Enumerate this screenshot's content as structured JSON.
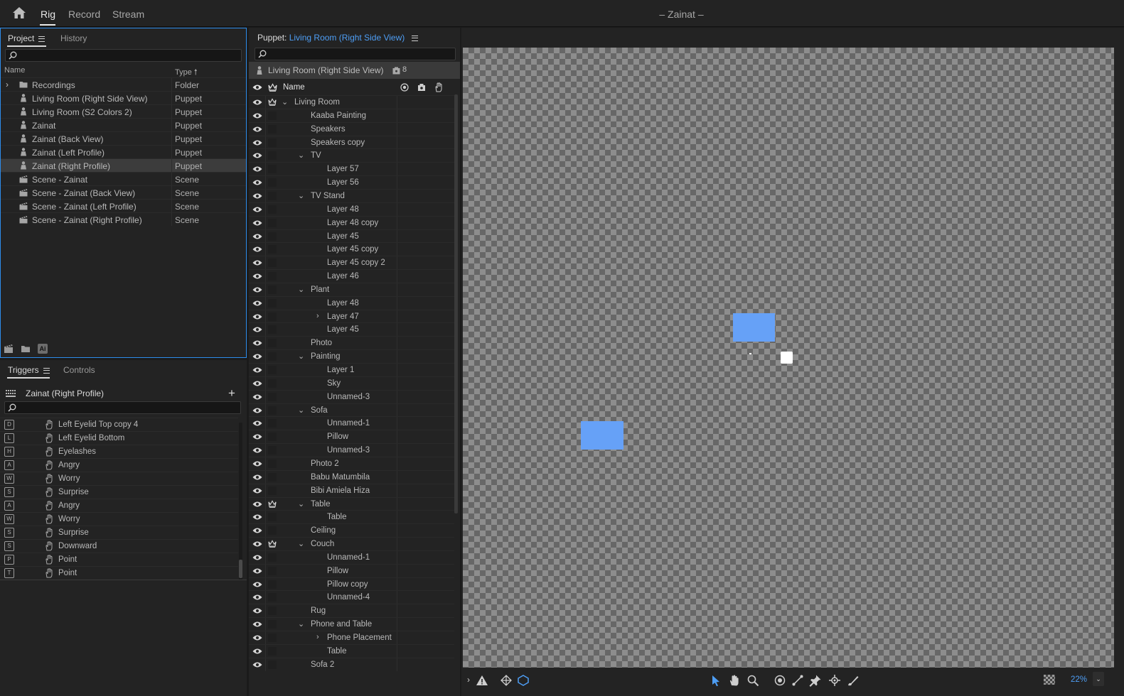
{
  "workspace": {
    "tabs": [
      "Rig",
      "Record",
      "Stream"
    ],
    "active_tab": "Rig",
    "title": "– Zainat –"
  },
  "project_panel": {
    "tabs": [
      "Project",
      "History"
    ],
    "search_placeholder": "",
    "columns": {
      "name": "Name",
      "type": "Type"
    },
    "items": [
      {
        "name": "Recordings",
        "type": "Folder",
        "icon": "folder-icon"
      },
      {
        "name": "Living Room (Right Side View)",
        "type": "Puppet",
        "icon": "puppet-icon"
      },
      {
        "name": "Living Room (S2 Colors 2)",
        "type": "Puppet",
        "icon": "puppet-icon"
      },
      {
        "name": "Zainat",
        "type": "Puppet",
        "icon": "puppet-icon"
      },
      {
        "name": "Zainat (Back View)",
        "type": "Puppet",
        "icon": "puppet-icon"
      },
      {
        "name": "Zainat (Left Profile)",
        "type": "Puppet",
        "icon": "puppet-icon"
      },
      {
        "name": "Zainat (Right Profile)",
        "type": "Puppet",
        "icon": "puppet-icon",
        "selected": true
      },
      {
        "name": "Scene - Zainat",
        "type": "Scene",
        "icon": "scene-icon"
      },
      {
        "name": "Scene - Zainat (Back View)",
        "type": "Scene",
        "icon": "scene-icon"
      },
      {
        "name": "Scene - Zainat (Left Profile)",
        "type": "Scene",
        "icon": "scene-icon"
      },
      {
        "name": "Scene - Zainat (Right Profile)",
        "type": "Scene",
        "icon": "scene-icon"
      }
    ],
    "footer_ai_label": "Ai"
  },
  "triggers_panel": {
    "tabs": [
      "Triggers",
      "Controls"
    ],
    "puppet_name": "Zainat (Right Profile)",
    "add_label": "+",
    "items": [
      {
        "key": "D",
        "name": "Left Eyelid Top copy 4"
      },
      {
        "key": "L",
        "name": "Left Eyelid Bottom"
      },
      {
        "key": "H",
        "name": "Eyelashes"
      },
      {
        "key": "A",
        "name": "Angry"
      },
      {
        "key": "W",
        "name": "Worry"
      },
      {
        "key": "S",
        "name": "Surprise"
      },
      {
        "key": "A",
        "name": "Angry"
      },
      {
        "key": "W",
        "name": "Worry"
      },
      {
        "key": "S",
        "name": "Surprise"
      },
      {
        "key": "S",
        "name": "Downward"
      },
      {
        "key": "P",
        "name": "Point"
      },
      {
        "key": "T",
        "name": "Point"
      }
    ]
  },
  "puppet_panel": {
    "title_label": "Puppet:",
    "puppet_name": "Living Room (Right Side View)",
    "crumb_name": "Living Room (Right Side View)",
    "crumb_count": "8",
    "name_header": "Name",
    "layers": [
      {
        "name": "Living Room",
        "depth": 0,
        "twirl": "open",
        "crown": true
      },
      {
        "name": "Kaaba Painting",
        "depth": 1
      },
      {
        "name": "Speakers",
        "depth": 1
      },
      {
        "name": "Speakers copy",
        "depth": 1
      },
      {
        "name": "TV",
        "depth": 1,
        "twirl": "open"
      },
      {
        "name": "Layer 57",
        "depth": 2
      },
      {
        "name": "Layer 56",
        "depth": 2
      },
      {
        "name": "TV Stand",
        "depth": 1,
        "twirl": "open"
      },
      {
        "name": "Layer 48",
        "depth": 2
      },
      {
        "name": "Layer 48 copy",
        "depth": 2
      },
      {
        "name": "Layer 45",
        "depth": 2
      },
      {
        "name": "Layer 45 copy",
        "depth": 2
      },
      {
        "name": "Layer 45 copy 2",
        "depth": 2
      },
      {
        "name": "Layer 46",
        "depth": 2
      },
      {
        "name": "Plant",
        "depth": 1,
        "twirl": "open"
      },
      {
        "name": "Layer 48",
        "depth": 2
      },
      {
        "name": "Layer 47",
        "depth": 2,
        "twirl": "closed"
      },
      {
        "name": "Layer 45",
        "depth": 2
      },
      {
        "name": "Photo",
        "depth": 1
      },
      {
        "name": "Painting",
        "depth": 1,
        "twirl": "open"
      },
      {
        "name": "Layer 1",
        "depth": 2
      },
      {
        "name": "Sky",
        "depth": 2
      },
      {
        "name": "Unnamed-3",
        "depth": 2
      },
      {
        "name": "Sofa",
        "depth": 1,
        "twirl": "open"
      },
      {
        "name": "Unnamed-1",
        "depth": 2
      },
      {
        "name": "Pillow",
        "depth": 2
      },
      {
        "name": "Unnamed-3",
        "depth": 2
      },
      {
        "name": "Photo 2",
        "depth": 1
      },
      {
        "name": "Babu Matumbila",
        "depth": 1
      },
      {
        "name": "Bibi Amiela Hiza",
        "depth": 1
      },
      {
        "name": "Table",
        "depth": 1,
        "twirl": "open",
        "crown": true
      },
      {
        "name": "Table",
        "depth": 2
      },
      {
        "name": "Ceiling",
        "depth": 1
      },
      {
        "name": "Couch",
        "depth": 1,
        "twirl": "open",
        "crown": true
      },
      {
        "name": "Unnamed-1",
        "depth": 2
      },
      {
        "name": "Pillow",
        "depth": 2
      },
      {
        "name": "Pillow copy",
        "depth": 2
      },
      {
        "name": "Unnamed-4",
        "depth": 2
      },
      {
        "name": "Rug",
        "depth": 1
      },
      {
        "name": "Phone and Table",
        "depth": 1,
        "twirl": "open"
      },
      {
        "name": "Phone Placement",
        "depth": 2,
        "twirl": "closed"
      },
      {
        "name": "Table",
        "depth": 2
      },
      {
        "name": "Sofa 2",
        "depth": 1
      }
    ]
  },
  "stage": {
    "zoom": "22%",
    "accent_color": "#4e9ef5",
    "shape_color": "#66a1f7"
  }
}
